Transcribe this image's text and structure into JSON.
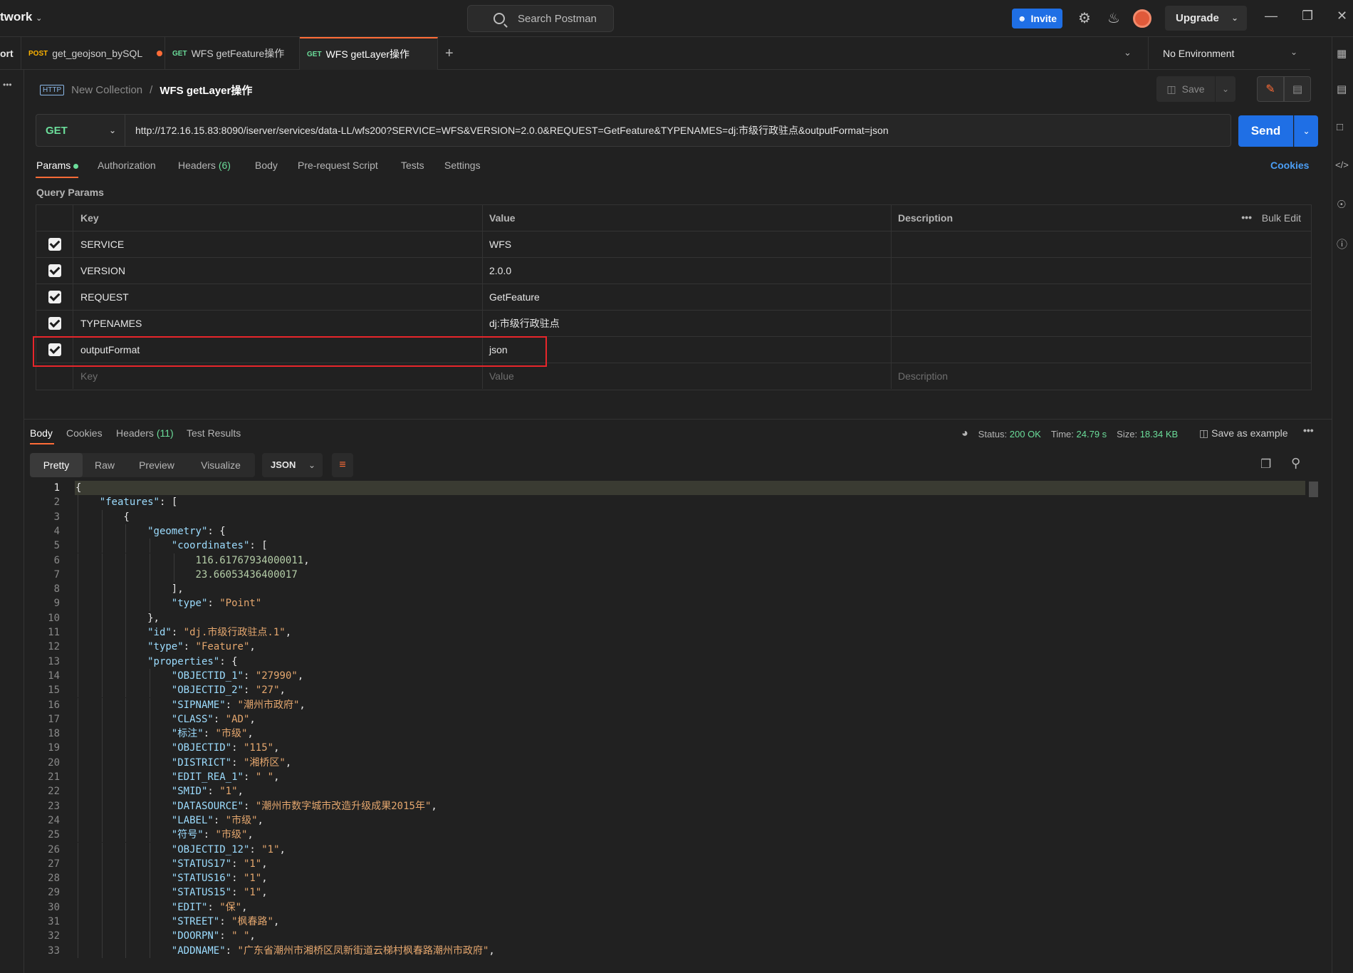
{
  "titlebar": {
    "workspace": "twork",
    "search_placeholder": "Search Postman",
    "invite_label": "Invite",
    "upgrade_label": "Upgrade"
  },
  "tabs": {
    "partial_left": "ort",
    "items": [
      {
        "method": "POST",
        "label": "get_geojson_bySQL"
      },
      {
        "method": "GET",
        "label": "WFS getFeature操作"
      },
      {
        "method": "GET",
        "label": "WFS getLayer操作"
      }
    ],
    "add_label": "+"
  },
  "environment": "No Environment",
  "breadcrumb": {
    "icon_text": "HTTP",
    "collection": "New Collection",
    "separator": "/",
    "request": "WFS getLayer操作"
  },
  "save_label": "Save",
  "request": {
    "method": "GET",
    "url": "http://172.16.15.83:8090/iserver/services/data-LL/wfs200?SERVICE=WFS&VERSION=2.0.0&REQUEST=GetFeature&TYPENAMES=dj:市级行政驻点&outputFormat=json",
    "send_label": "Send"
  },
  "request_tabs": {
    "params": "Params",
    "authorization": "Authorization",
    "headers": "Headers",
    "headers_count": "(6)",
    "body": "Body",
    "pre_request": "Pre-request Script",
    "tests": "Tests",
    "settings": "Settings",
    "cookies": "Cookies"
  },
  "query_params": {
    "title": "Query Params",
    "header": {
      "key": "Key",
      "value": "Value",
      "description": "Description",
      "bulk_edit": "Bulk Edit",
      "more": "•••"
    },
    "rows": [
      {
        "key": "SERVICE",
        "value": "WFS"
      },
      {
        "key": "VERSION",
        "value": "2.0.0"
      },
      {
        "key": "REQUEST",
        "value": "GetFeature"
      },
      {
        "key": "TYPENAMES",
        "value": "dj:市级行政驻点"
      },
      {
        "key": "outputFormat",
        "value": "json"
      }
    ],
    "placeholder": {
      "key": "Key",
      "value": "Value",
      "description": "Description"
    }
  },
  "response": {
    "tabs": {
      "body": "Body",
      "cookies": "Cookies",
      "headers": "Headers",
      "headers_count": "(11)",
      "test_results": "Test Results"
    },
    "status_label": "Status:",
    "status_value": "200 OK",
    "time_label": "Time:",
    "time_value": "24.79 s",
    "size_label": "Size:",
    "size_value": "18.34 KB",
    "save_example": "Save as example",
    "more": "•••",
    "views": [
      "Pretty",
      "Raw",
      "Preview",
      "Visualize"
    ],
    "format": "JSON"
  },
  "code_lines": [
    {
      "n": "1",
      "indent": 0,
      "parts": [
        [
          "p",
          "{"
        ]
      ]
    },
    {
      "n": "2",
      "indent": 1,
      "parts": [
        [
          "k",
          "\"features\""
        ],
        [
          "p",
          ": ["
        ]
      ]
    },
    {
      "n": "3",
      "indent": 2,
      "parts": [
        [
          "p",
          "{"
        ]
      ]
    },
    {
      "n": "4",
      "indent": 3,
      "parts": [
        [
          "k",
          "\"geometry\""
        ],
        [
          "p",
          ": {"
        ]
      ]
    },
    {
      "n": "5",
      "indent": 4,
      "parts": [
        [
          "k",
          "\"coordinates\""
        ],
        [
          "p",
          ": ["
        ]
      ]
    },
    {
      "n": "6",
      "indent": 5,
      "parts": [
        [
          "n",
          "116.61767934000011"
        ],
        [
          "p",
          ","
        ]
      ]
    },
    {
      "n": "7",
      "indent": 5,
      "parts": [
        [
          "n",
          "23.66053436400017"
        ]
      ]
    },
    {
      "n": "8",
      "indent": 4,
      "parts": [
        [
          "p",
          "],"
        ]
      ]
    },
    {
      "n": "9",
      "indent": 4,
      "parts": [
        [
          "k",
          "\"type\""
        ],
        [
          "p",
          ": "
        ],
        [
          "s",
          "\"Point\""
        ]
      ]
    },
    {
      "n": "10",
      "indent": 3,
      "parts": [
        [
          "p",
          "},"
        ]
      ]
    },
    {
      "n": "11",
      "indent": 3,
      "parts": [
        [
          "k",
          "\"id\""
        ],
        [
          "p",
          ": "
        ],
        [
          "s",
          "\"dj.市级行政驻点.1\""
        ],
        [
          "p",
          ","
        ]
      ]
    },
    {
      "n": "12",
      "indent": 3,
      "parts": [
        [
          "k",
          "\"type\""
        ],
        [
          "p",
          ": "
        ],
        [
          "s",
          "\"Feature\""
        ],
        [
          "p",
          ","
        ]
      ]
    },
    {
      "n": "13",
      "indent": 3,
      "parts": [
        [
          "k",
          "\"properties\""
        ],
        [
          "p",
          ": {"
        ]
      ]
    },
    {
      "n": "14",
      "indent": 4,
      "parts": [
        [
          "k",
          "\"OBJECTID_1\""
        ],
        [
          "p",
          ": "
        ],
        [
          "s",
          "\"27990\""
        ],
        [
          "p",
          ","
        ]
      ]
    },
    {
      "n": "15",
      "indent": 4,
      "parts": [
        [
          "k",
          "\"OBJECTID_2\""
        ],
        [
          "p",
          ": "
        ],
        [
          "s",
          "\"27\""
        ],
        [
          "p",
          ","
        ]
      ]
    },
    {
      "n": "16",
      "indent": 4,
      "parts": [
        [
          "k",
          "\"SIPNAME\""
        ],
        [
          "p",
          ": "
        ],
        [
          "s",
          "\"潮州市政府\""
        ],
        [
          "p",
          ","
        ]
      ]
    },
    {
      "n": "17",
      "indent": 4,
      "parts": [
        [
          "k",
          "\"CLASS\""
        ],
        [
          "p",
          ": "
        ],
        [
          "s",
          "\"AD\""
        ],
        [
          "p",
          ","
        ]
      ]
    },
    {
      "n": "18",
      "indent": 4,
      "parts": [
        [
          "k",
          "\"标注\""
        ],
        [
          "p",
          ": "
        ],
        [
          "s",
          "\"市级\""
        ],
        [
          "p",
          ","
        ]
      ]
    },
    {
      "n": "19",
      "indent": 4,
      "parts": [
        [
          "k",
          "\"OBJECTID\""
        ],
        [
          "p",
          ": "
        ],
        [
          "s",
          "\"115\""
        ],
        [
          "p",
          ","
        ]
      ]
    },
    {
      "n": "20",
      "indent": 4,
      "parts": [
        [
          "k",
          "\"DISTRICT\""
        ],
        [
          "p",
          ": "
        ],
        [
          "s",
          "\"湘桥区\""
        ],
        [
          "p",
          ","
        ]
      ]
    },
    {
      "n": "21",
      "indent": 4,
      "parts": [
        [
          "k",
          "\"EDIT_REA_1\""
        ],
        [
          "p",
          ": "
        ],
        [
          "s",
          "\" \""
        ],
        [
          "p",
          ","
        ]
      ]
    },
    {
      "n": "22",
      "indent": 4,
      "parts": [
        [
          "k",
          "\"SMID\""
        ],
        [
          "p",
          ": "
        ],
        [
          "s",
          "\"1\""
        ],
        [
          "p",
          ","
        ]
      ]
    },
    {
      "n": "23",
      "indent": 4,
      "parts": [
        [
          "k",
          "\"DATASOURCE\""
        ],
        [
          "p",
          ": "
        ],
        [
          "s",
          "\"潮州市数字城市改造升级成果2015年\""
        ],
        [
          "p",
          ","
        ]
      ]
    },
    {
      "n": "24",
      "indent": 4,
      "parts": [
        [
          "k",
          "\"LABEL\""
        ],
        [
          "p",
          ": "
        ],
        [
          "s",
          "\"市级\""
        ],
        [
          "p",
          ","
        ]
      ]
    },
    {
      "n": "25",
      "indent": 4,
      "parts": [
        [
          "k",
          "\"符号\""
        ],
        [
          "p",
          ": "
        ],
        [
          "s",
          "\"市级\""
        ],
        [
          "p",
          ","
        ]
      ]
    },
    {
      "n": "26",
      "indent": 4,
      "parts": [
        [
          "k",
          "\"OBJECTID_12\""
        ],
        [
          "p",
          ": "
        ],
        [
          "s",
          "\"1\""
        ],
        [
          "p",
          ","
        ]
      ]
    },
    {
      "n": "27",
      "indent": 4,
      "parts": [
        [
          "k",
          "\"STATUS17\""
        ],
        [
          "p",
          ": "
        ],
        [
          "s",
          "\"1\""
        ],
        [
          "p",
          ","
        ]
      ]
    },
    {
      "n": "28",
      "indent": 4,
      "parts": [
        [
          "k",
          "\"STATUS16\""
        ],
        [
          "p",
          ": "
        ],
        [
          "s",
          "\"1\""
        ],
        [
          "p",
          ","
        ]
      ]
    },
    {
      "n": "29",
      "indent": 4,
      "parts": [
        [
          "k",
          "\"STATUS15\""
        ],
        [
          "p",
          ": "
        ],
        [
          "s",
          "\"1\""
        ],
        [
          "p",
          ","
        ]
      ]
    },
    {
      "n": "30",
      "indent": 4,
      "parts": [
        [
          "k",
          "\"EDIT\""
        ],
        [
          "p",
          ": "
        ],
        [
          "s",
          "\"保\""
        ],
        [
          "p",
          ","
        ]
      ]
    },
    {
      "n": "31",
      "indent": 4,
      "parts": [
        [
          "k",
          "\"STREET\""
        ],
        [
          "p",
          ": "
        ],
        [
          "s",
          "\"枫春路\""
        ],
        [
          "p",
          ","
        ]
      ]
    },
    {
      "n": "32",
      "indent": 4,
      "parts": [
        [
          "k",
          "\"DOORPN\""
        ],
        [
          "p",
          ": "
        ],
        [
          "s",
          "\" \""
        ],
        [
          "p",
          ","
        ]
      ]
    },
    {
      "n": "33",
      "indent": 4,
      "parts": [
        [
          "k",
          "\"ADDNAME\""
        ],
        [
          "p",
          ": "
        ],
        [
          "s",
          "\"广东省潮州市湘桥区凤新街道云梯村枫春路潮州市政府\""
        ],
        [
          "p",
          ","
        ]
      ]
    }
  ]
}
